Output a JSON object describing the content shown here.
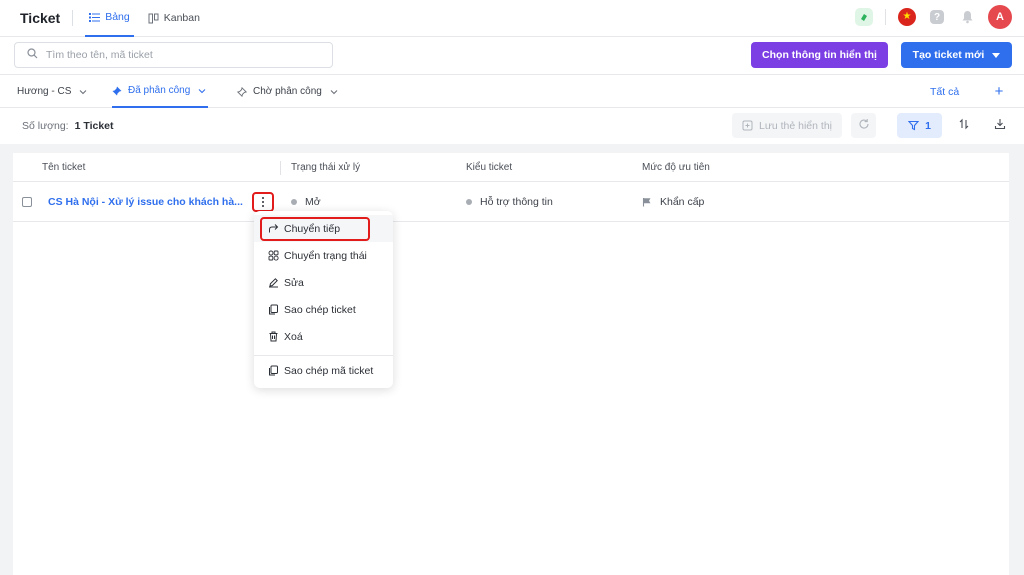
{
  "header": {
    "title": "Ticket",
    "views": [
      {
        "label": "Bảng",
        "active": true
      },
      {
        "label": "Kanban",
        "active": false
      }
    ],
    "avatar_letter": "A"
  },
  "toolbar": {
    "search_placeholder": "Tìm theo tên, mã ticket",
    "choose_display_label": "Chọn thông tin hiển thị",
    "create_ticket_label": "Tạo ticket mới"
  },
  "filters": {
    "tabs": [
      {
        "label": "Hương - CS"
      },
      {
        "label": "Đã phân công"
      },
      {
        "label": "Chờ phân công"
      }
    ],
    "all_label": "Tất cả",
    "add_label": "+"
  },
  "summary": {
    "count_label": "Số lượng:",
    "count_value": "1 Ticket",
    "save_view_label": "Lưu thẻ hiển thị",
    "filter_count": "1"
  },
  "table": {
    "columns": [
      "Tên ticket",
      "Trạng thái xử lý",
      "Kiểu ticket",
      "Mức độ ưu tiên"
    ],
    "rows": [
      {
        "name": "CS Hà Nội - Xử lý issue cho khách hà...",
        "status": "Mở",
        "type": "Hỗ trợ thông tin",
        "priority": "Khẩn cấp"
      }
    ]
  },
  "context_menu": {
    "items": [
      {
        "label": "Chuyển tiếp",
        "icon": "forward-icon"
      },
      {
        "label": "Chuyển trạng thái",
        "icon": "status-icon"
      },
      {
        "label": "Sửa",
        "icon": "edit-icon"
      },
      {
        "label": "Sao chép ticket",
        "icon": "copy-icon"
      },
      {
        "label": "Xoá",
        "icon": "trash-icon"
      },
      {
        "label": "Sao chép mã ticket",
        "icon": "copy-code-icon"
      }
    ]
  },
  "colors": {
    "primary": "#2f6fed",
    "purple": "#7b3fe4",
    "highlight": "#e21b1b",
    "avatar": "#e5484d"
  }
}
